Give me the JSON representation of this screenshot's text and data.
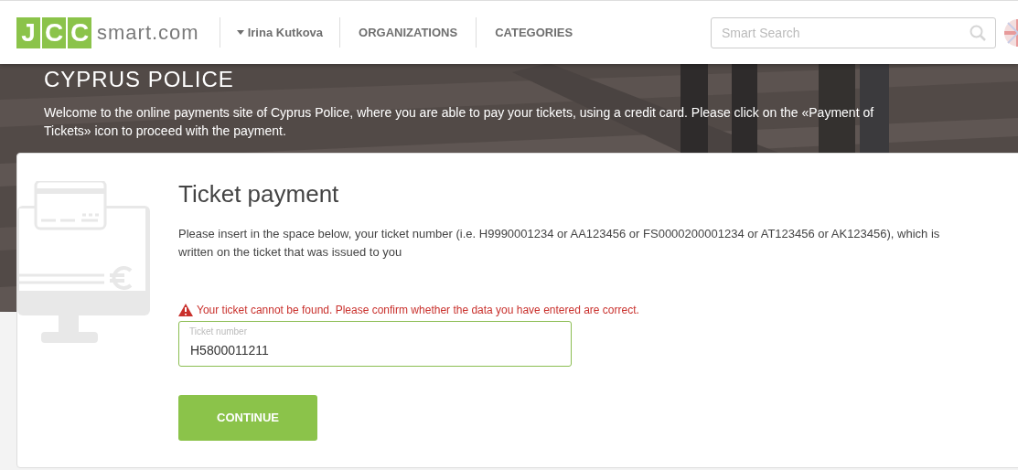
{
  "header": {
    "logo": {
      "mark": [
        "J",
        "C",
        "C"
      ],
      "text": "smart.com"
    },
    "user_menu": {
      "label": "Irina Kutkova"
    },
    "nav": [
      {
        "label": "ORGANIZATIONS"
      },
      {
        "label": "CATEGORIES"
      }
    ],
    "search": {
      "placeholder": "Smart Search"
    }
  },
  "hero": {
    "title": "CYPRUS POLICE",
    "intro": "Welcome to the online payments site of Cyprus Police, where you are able to pay your tickets, using a credit card. Please click on the «Payment of Tickets» icon to proceed with the payment."
  },
  "card": {
    "title": "Ticket payment",
    "instructions": "Please insert in the space below, your ticket number (i.e. H9990001234 or AA123456 or FS0000200001234 or AT123456 or AK123456), which is written on the ticket that was issued to you",
    "error": "Your ticket cannot be found. Please confirm whether the data you have entered are correct.",
    "field": {
      "label": "Ticket number",
      "value": "H5800011211"
    },
    "button": "CONTINUE"
  }
}
